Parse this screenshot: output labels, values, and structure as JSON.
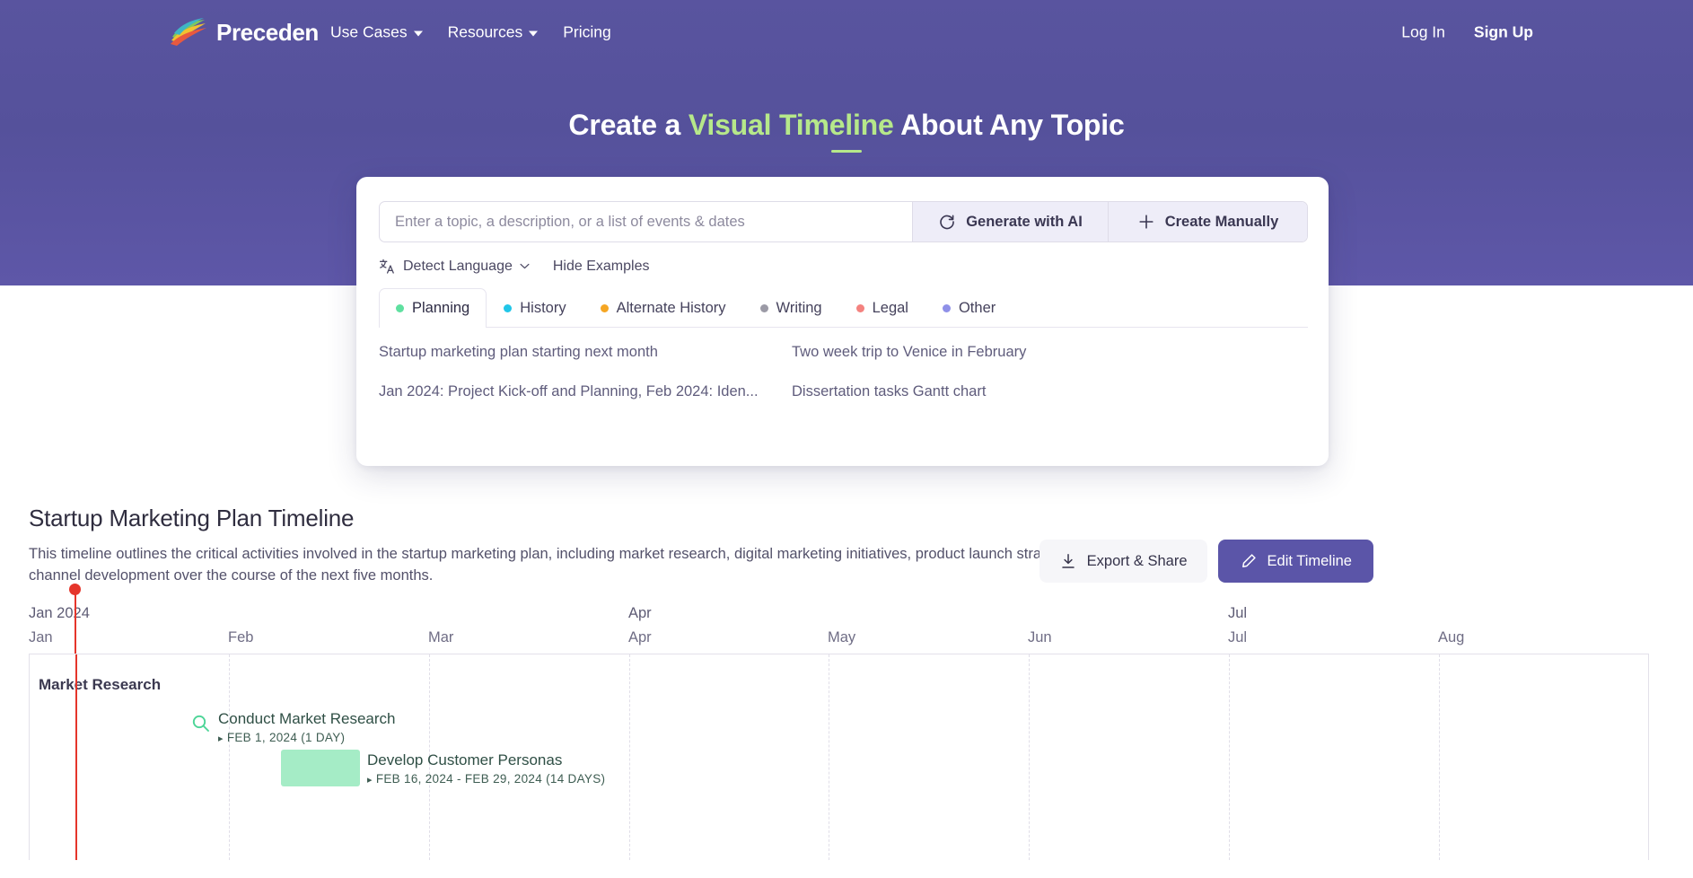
{
  "nav": {
    "brand": "Preceden",
    "brand_icon": "preceden-swoosh-logo",
    "links": [
      {
        "label": "Use Cases",
        "has_caret": true
      },
      {
        "label": "Resources",
        "has_caret": true
      },
      {
        "label": "Pricing",
        "has_caret": false
      }
    ],
    "login": "Log In",
    "signup": "Sign Up"
  },
  "hero": {
    "headline_pre": "Create a ",
    "headline_accent": "Visual Timeline",
    "headline_post": " About Any Topic",
    "accent_color": "#b6e88a",
    "background_color": "#5a549f"
  },
  "search": {
    "placeholder": "Enter a topic, a description, or a list of events & dates",
    "value": "",
    "generate_label": "Generate with AI",
    "generate_icon": "refresh-ai-icon",
    "manual_label": "Create Manually",
    "manual_icon": "plus-icon",
    "detect_language_label": "Detect Language",
    "detect_language_icon": "translate-icon",
    "detect_chevron_icon": "chevron-down-icon",
    "hide_examples_label": "Hide Examples"
  },
  "tabs": [
    {
      "label": "Planning",
      "color": "#5fe0a0",
      "active": true
    },
    {
      "label": "History",
      "color": "#21c6e8",
      "active": false
    },
    {
      "label": "Alternate History",
      "color": "#f5a623",
      "active": false
    },
    {
      "label": "Writing",
      "color": "#9b9aa6",
      "active": false
    },
    {
      "label": "Legal",
      "color": "#f4827f",
      "active": false
    },
    {
      "label": "Other",
      "color": "#8f90e8",
      "active": false
    }
  ],
  "examples": [
    "Startup marketing plan starting next month",
    "Two week trip to Venice in February",
    "Jan 2024: Project Kick-off and Planning, Feb 2024: Iden...",
    "Dissertation tasks Gantt chart"
  ],
  "timeline": {
    "title": "Startup Marketing Plan Timeline",
    "description": "This timeline outlines the critical activities involved in the startup marketing plan, including market research, digital marketing initiatives, product launch strategy, and sales channel development over the course of the next five months.",
    "export_label": "Export & Share",
    "export_icon": "download-icon",
    "edit_label": "Edit Timeline",
    "edit_icon": "pencil-icon",
    "edit_button_color": "#5b55a8"
  },
  "chart_data": {
    "type": "gantt",
    "title": "Startup Marketing Plan Timeline",
    "year_label": "Jan 2024",
    "axis_top_ticks": [
      "Jan 2024",
      "Apr",
      "Jul"
    ],
    "axis_bottom_ticks": [
      "Jan",
      "Feb",
      "Mar",
      "Apr",
      "May",
      "Jun",
      "Jul",
      "Aug"
    ],
    "today_marker": {
      "label": "",
      "color": "#e5352b",
      "position_month": "Jan 2024"
    },
    "lanes": [
      {
        "name": "Market Research",
        "items": [
          {
            "name": "Conduct Market Research",
            "date_text": "FEB 1, 2024 (1 DAY)",
            "start": "2024-02-01",
            "end": "2024-02-01",
            "duration_days": 1,
            "kind": "milestone",
            "icon": "magnifier-icon",
            "color": "#4ed598"
          },
          {
            "name": "Develop Customer Personas",
            "date_text": "FEB 16, 2024 - FEB 29, 2024 (14 DAYS)",
            "start": "2024-02-16",
            "end": "2024-02-29",
            "duration_days": 14,
            "kind": "bar",
            "color": "#a5ecc6"
          }
        ]
      }
    ]
  }
}
